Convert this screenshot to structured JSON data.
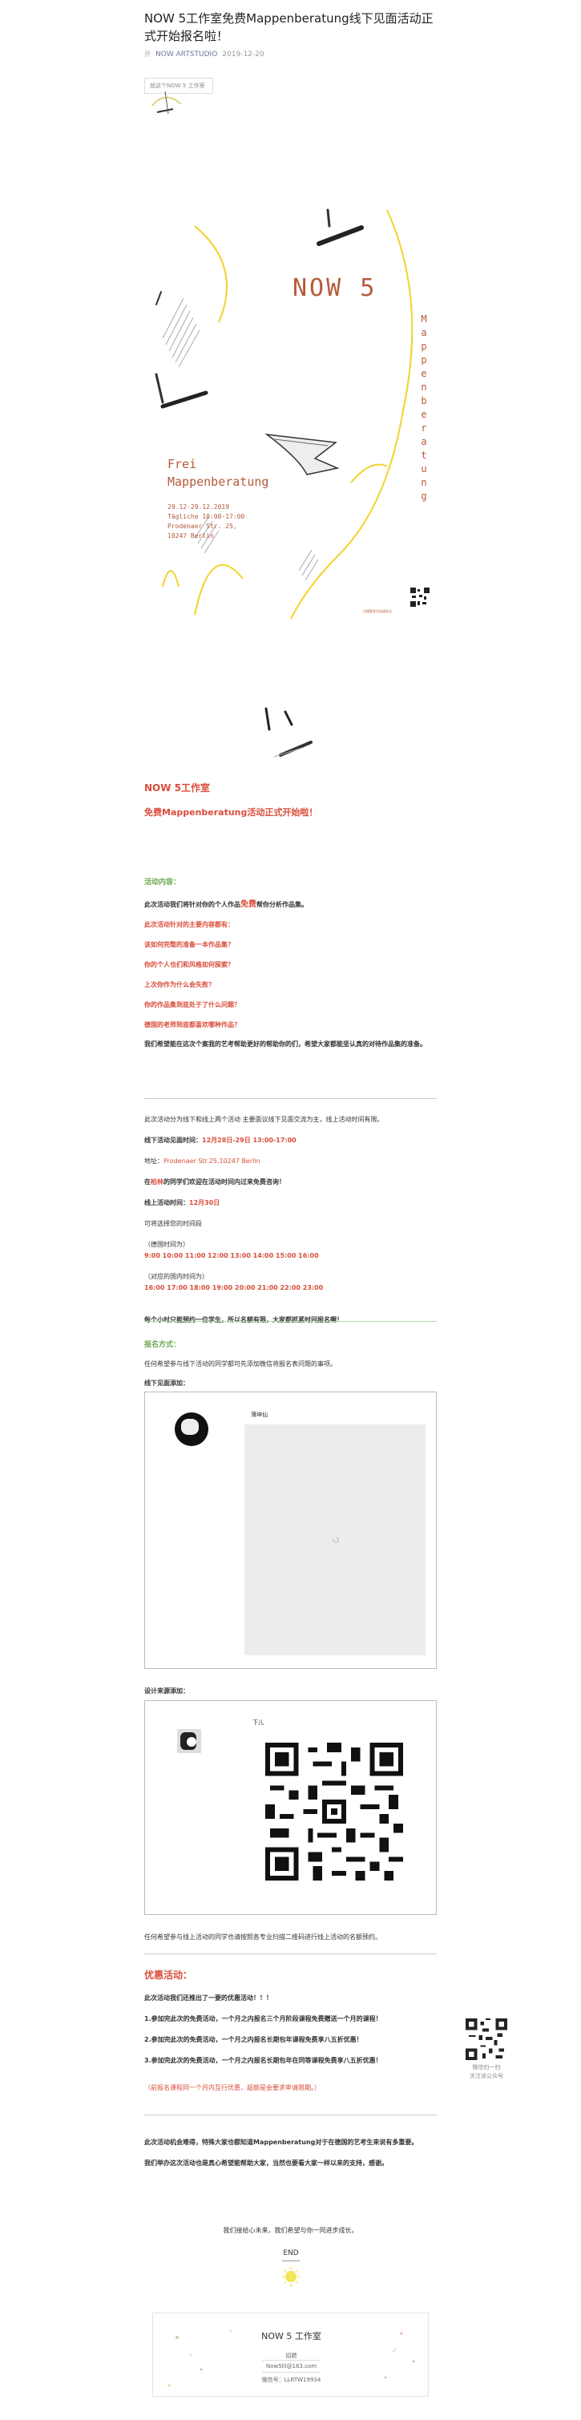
{
  "article": {
    "title": "NOW 5工作室免费Mappenberatung线下见面活动正式开始报名啦！",
    "meta_author": "NOW ARTSTUDIO",
    "meta_date": "2019-12-20",
    "notice": "就这个NOW 5 工作室"
  },
  "poster": {
    "title": "NOW 5",
    "frei_line1": "Frei",
    "frei_line2": "Mappenberatung",
    "details": "29.12-29.12.2019\nTägliche 10:00-17:00\nProdenaer Str. 25,\n10247 Berlin",
    "vertical": [
      "M",
      "a",
      "p",
      "p",
      "e",
      "n",
      "b",
      "e",
      "r",
      "a",
      "t",
      "u",
      "n",
      "g"
    ],
    "qr_caption": "扫描更多活动请关注"
  },
  "intro": {
    "studio": "NOW 5工作室",
    "headline": "免费Mappenberatung活动正式开始啦！",
    "section_label": "活动内容：",
    "lead_prefix": "此次活动我们将针对你的个人作品",
    "lead_highlight": "免费",
    "lead_suffix": "帮你分析作品集。",
    "questions": [
      "此次活动针对的主要内容都有：",
      "该如何完整的准备一本作品集？",
      "你的个人也们和风格如何探索？",
      "上次你作为什么会失败？",
      "你的作品集到底处于了什么问题？",
      "德国的老师到底都喜欢哪种作品？"
    ],
    "closing": "我们希望能在这次个案我的艺考帮助更好的帮助你的们，希望大家都能坚认真的对待作品集的准备。"
  },
  "schedule": {
    "intro_text": "此次活动分为线下和线上两个活动  主要面议线下见面交流为主，线上活动时间有限。",
    "offline_label": "线下活动见面时间：",
    "offline_time": "12月28日-29日 13:00-17:00",
    "address_label": "地址：",
    "address": "Prodenaer Str.25,10247 Berlin",
    "berlin_note_pre": "在",
    "berlin_note_highlight": "柏林",
    "berlin_note_post": "的同学们欢迎在活动时间内过来免费咨询！",
    "online_label": "线上活动时间：",
    "online_time": "12月30日",
    "choose_time": "可将选择您的时间段",
    "de_time_label": "（德国时间为）",
    "de_times": "9:00  10:00  11:00  12:00  13:00  14:00  15:00  16:00",
    "cn_time_label": "（对应的国内时间为）",
    "cn_times": "16:00  17:00  18:00  19:00  20:00  21:00  22:00  23:00",
    "warning": "每个小时只能预约一位学生，所以名额有限，大家都抓紧时间报名啊！"
  },
  "signup": {
    "label": "报名方式：",
    "desc": "任何希望参与线下活动的同学都可先添加微信将报名表问题的事项。",
    "first_contact": "线下见面添加：",
    "first_name": "薄坤仙",
    "second_contact": "设计来源添加：",
    "second_name": "下儿",
    "footer_note": "任何希望参与线上活动的同学也请按照各专业扫描二维码进行线上活动的名额预约。"
  },
  "promo": {
    "heading": "优惠活动：",
    "lead": "此次活动我们还推出了一要的优惠活动！！！",
    "items": [
      "1.参加完此次的免费活动，一个月之内报名三个月阶段课程免费赠送一个月的课程！",
      "2.参加完此次的免费活动，一个月之内报名长期包年课程免费享八五折优惠！",
      "3.参加完此次的免费活动，一个月之内报名长期包年在同等课程免费享八五折优惠！"
    ],
    "note": "（前报名课程同一个月内互行优惠，超额是会要求申请限期。）"
  },
  "final": {
    "line1": "此次活动机会难得，特殊大家也都知道Mappenberatung对于在德国的艺考生来说有多重要。",
    "line2": "我们举办这次活动也是真心希望能帮助大家，当然也要看大家一样以来的支持，感谢。",
    "follow": "我们接给心未来，我们希望与你一同进步成长。",
    "end": "END"
  },
  "sidebar": {
    "line1": "微信扫一扫",
    "line2": "关注该公众号"
  },
  "card": {
    "studio": "NOW 5 工作室",
    "wechat_label": "招聘",
    "email": "Now5lll@163.com",
    "wechat_id": "微信号：LLRTW19934"
  },
  "colors": {
    "accent": "#d94e3a",
    "green": "#6aa84f",
    "poster_text": "#b55a3a",
    "poster_yellow": "#f2d32b"
  }
}
